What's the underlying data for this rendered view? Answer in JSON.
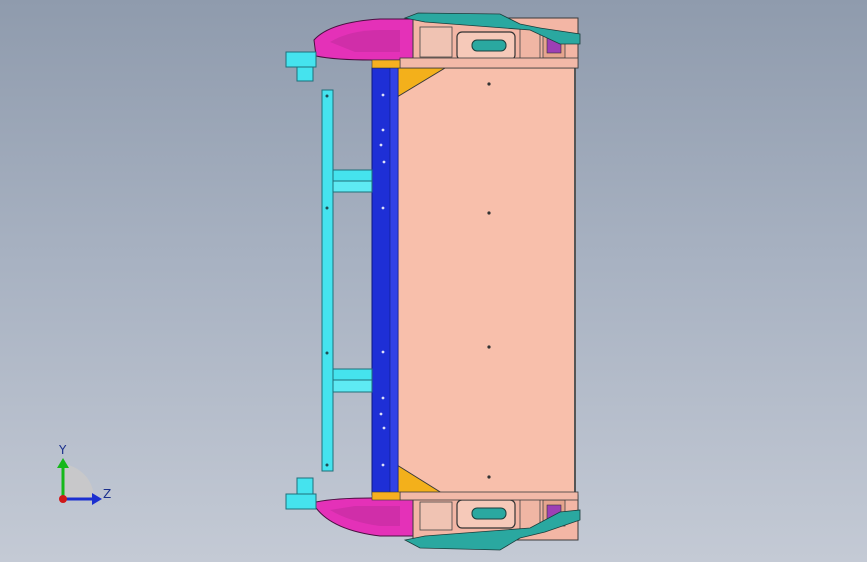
{
  "viewport": {
    "background_top": "#8f9bad",
    "background_bottom": "#c4cad5"
  },
  "model": {
    "colors": {
      "panel": "#f8bfab",
      "rail_blue": "#1e2fd6",
      "frame_cyan": "#45e3ee",
      "gusset_yellow": "#f3b01b",
      "housing_magenta": "#e431b8",
      "bracket_teal": "#2aa8a0",
      "outline": "#3a3a3a"
    },
    "part_icons": [
      "panel-body",
      "blue-rail",
      "cyan-frame",
      "corner-gusset",
      "end-housing",
      "mount-bracket"
    ]
  },
  "triad": {
    "y_label": "Y",
    "z_label": "Z",
    "colors": {
      "y": "#16b81a",
      "z": "#1b2fd0",
      "origin": "#d01818"
    }
  }
}
